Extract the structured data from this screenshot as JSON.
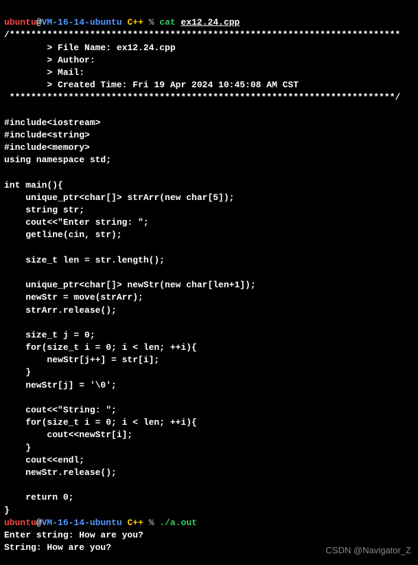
{
  "prompt1": {
    "user": "ubuntu",
    "at": "@",
    "host": "VM-16-14-ubuntu",
    "dir": "C++",
    "percent": "%",
    "cmd": "cat",
    "file": "ex12.24.cpp"
  },
  "header": {
    "topline": "/*************************************************************************",
    "filename": "        > File Name: ex12.24.cpp",
    "author": "        > Author: ",
    "mail": "        > Mail: ",
    "created": "        > Created Time: Fri 19 Apr 2024 10:45:08 AM CST",
    "botline": " ************************************************************************/"
  },
  "code": {
    "blank1": "",
    "inc1": "#include<iostream>",
    "inc2": "#include<string>",
    "inc3": "#include<memory>",
    "using": "using namespace std;",
    "blank2": "",
    "main": "int main(){",
    "l1": "    unique_ptr<char[]> strArr(new char[5]);",
    "l2": "    string str;",
    "l3": "    cout<<\"Enter string: \";",
    "l4": "    getline(cin, str);",
    "blank3": "",
    "l5": "    size_t len = str.length();",
    "blank4": "",
    "l6": "    unique_ptr<char[]> newStr(new char[len+1]);",
    "l7": "    newStr = move(strArr);",
    "l8": "    strArr.release();",
    "blank5": "",
    "l9": "    size_t j = 0;",
    "l10": "    for(size_t i = 0; i < len; ++i){",
    "l11": "        newStr[j++] = str[i];",
    "l12": "    }",
    "l13": "    newStr[j] = '\\0';",
    "blank6": "",
    "l14": "    cout<<\"String: \";",
    "l15": "    for(size_t i = 0; i < len; ++i){",
    "l16": "        cout<<newStr[i];",
    "l17": "    }",
    "l18": "    cout<<endl;",
    "l19": "    newStr.release();",
    "blank7": "",
    "l20": "    return 0;",
    "close": "}"
  },
  "prompt2": {
    "user": "ubuntu",
    "at": "@",
    "host": "VM-16-14-ubuntu",
    "dir": "C++",
    "percent": "%",
    "cmd": "./a.out"
  },
  "output": {
    "line1": "Enter string: How are you?",
    "line2": "String: How are you?"
  },
  "watermark": "CSDN @Navigator_Z"
}
